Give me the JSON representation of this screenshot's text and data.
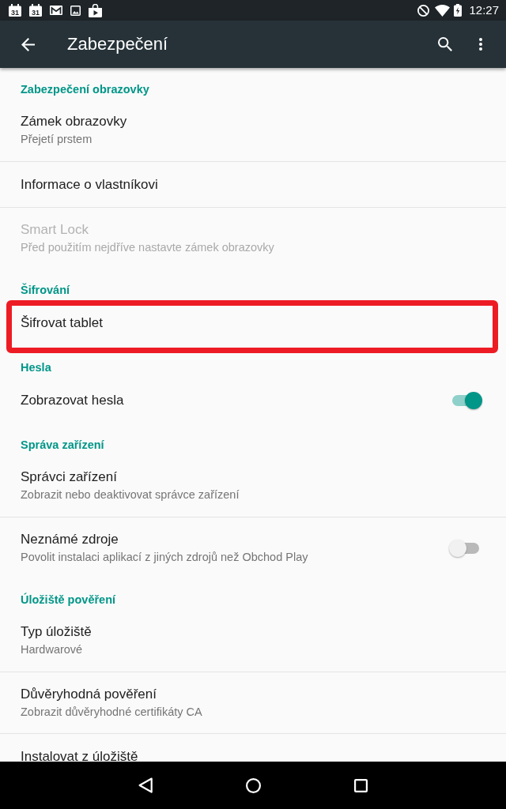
{
  "status_bar": {
    "notifications": [
      {
        "kind": "calendar",
        "day": "31"
      },
      {
        "kind": "calendar",
        "day": "31"
      },
      {
        "kind": "mail"
      },
      {
        "kind": "image"
      },
      {
        "kind": "store"
      }
    ],
    "time": "12:27"
  },
  "toolbar": {
    "title": "Zabezpečení"
  },
  "sections": [
    {
      "header": "Zabezpečení obrazovky",
      "items": [
        {
          "kind": "plain",
          "title": "Zámek obrazovky",
          "summary": "Přejetí prstem",
          "disabled": false,
          "highlighted": false
        },
        {
          "kind": "plain",
          "title": "Informace o vlastníkovi",
          "disabled": false,
          "highlighted": false
        },
        {
          "kind": "plain",
          "title": "Smart Lock",
          "summary": "Před použitím nejdříve nastavte zámek obrazovky",
          "disabled": true,
          "highlighted": false
        }
      ]
    },
    {
      "header": "Šifrování",
      "items": [
        {
          "kind": "plain",
          "title": "Šifrovat tablet",
          "disabled": false,
          "highlighted": true
        }
      ]
    },
    {
      "header": "Hesla",
      "items": [
        {
          "kind": "switch",
          "title": "Zobrazovat hesla",
          "on": true,
          "disabled": false,
          "highlighted": false
        }
      ]
    },
    {
      "header": "Správa zařízení",
      "items": [
        {
          "kind": "plain",
          "title": "Správci zařízení",
          "summary": "Zobrazit nebo deaktivovat správce zařízení",
          "disabled": false,
          "highlighted": false
        },
        {
          "kind": "switch",
          "title": "Neznámé zdroje",
          "summary": "Povolit instalaci aplikací z jiných zdrojů než Obchod Play",
          "on": false,
          "disabled": false,
          "highlighted": false
        }
      ]
    },
    {
      "header": "Úložiště pověření",
      "items": [
        {
          "kind": "plain",
          "title": "Typ úložiště",
          "summary": "Hardwarové",
          "disabled": false,
          "highlighted": false
        },
        {
          "kind": "plain",
          "title": "Důvěryhodná pověření",
          "summary": "Zobrazit důvěryhodné certifikáty CA",
          "disabled": false,
          "highlighted": false
        },
        {
          "kind": "plain",
          "title": "Instalovat z úložiště",
          "disabled": false,
          "highlighted": false
        }
      ]
    }
  ]
}
